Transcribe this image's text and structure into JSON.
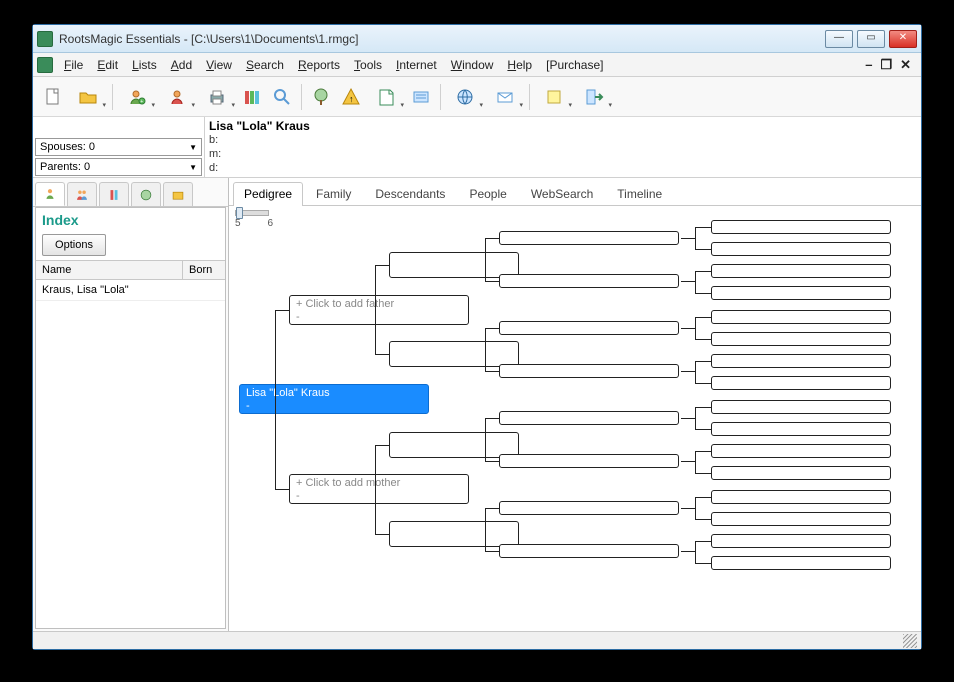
{
  "window": {
    "title": "RootsMagic Essentials - [C:\\Users\\1\\Documents\\1.rmgc]"
  },
  "menu": {
    "items": [
      "File",
      "Edit",
      "Lists",
      "Add",
      "View",
      "Search",
      "Reports",
      "Tools",
      "Internet",
      "Window",
      "Help",
      "[Purchase]"
    ]
  },
  "info": {
    "spouses_label": "Spouses: 0",
    "parents_label": "Parents: 0",
    "person_name": "Lisa \"Lola\" Kraus",
    "b": "b:",
    "m": "m:",
    "d": "d:"
  },
  "sidebar": {
    "index_title": "Index",
    "options_label": "Options",
    "headers": {
      "name": "Name",
      "born": "Born"
    },
    "rows": [
      {
        "name": "Kraus, Lisa \"Lola\"",
        "born": ""
      }
    ]
  },
  "views": {
    "tabs": [
      "Pedigree",
      "Family",
      "Descendants",
      "People",
      "WebSearch",
      "Timeline"
    ],
    "active": "Pedigree"
  },
  "generations": {
    "min": "5",
    "max": "6"
  },
  "pedigree": {
    "selected_name": "Lisa \"Lola\" Kraus",
    "add_father": "+ Click to add father",
    "add_mother": "+ Click to add mother",
    "dash": "-"
  }
}
